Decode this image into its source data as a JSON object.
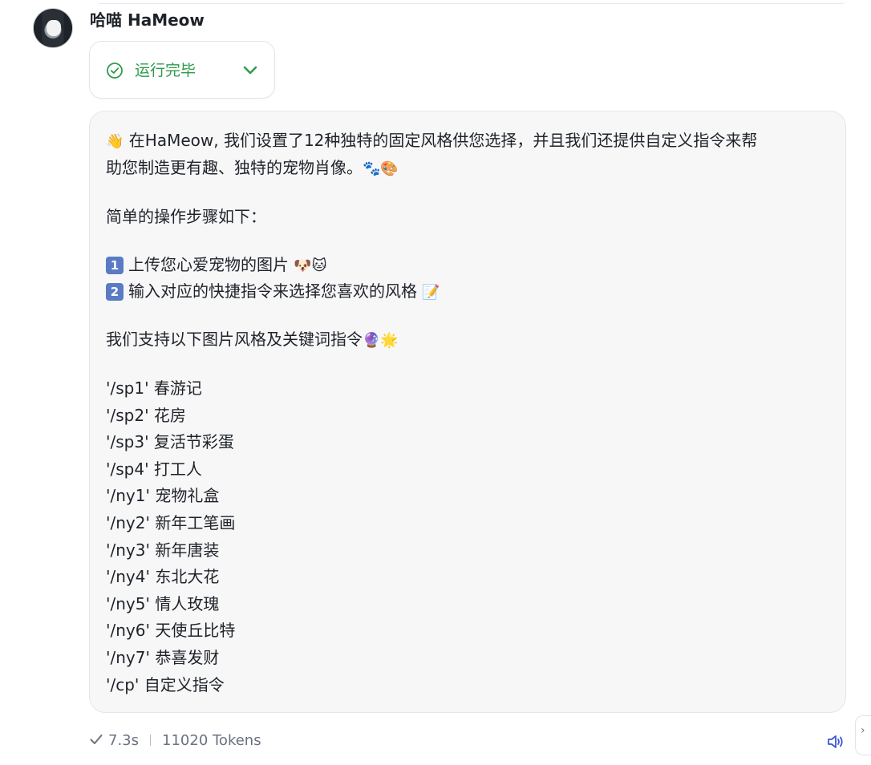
{
  "bot": {
    "name": "哈喵 HaMeow"
  },
  "status": {
    "label": "运行完毕",
    "icon": "check-circle-icon",
    "expand_icon": "chevron-down-icon",
    "color": "#2e9b4b"
  },
  "message": {
    "intro_emoji": "👋",
    "intro_line1": "在HaMeow, 我们设置了12种独特的固定风格供您选择，并且我们还提供自定义指令来帮",
    "intro_line2": "助您制造更有趣、独特的宠物肖像。",
    "intro_line2_emoji": "🐾🎨",
    "steps_title": "简单的操作步骤如下：",
    "steps": [
      {
        "badge": "1",
        "text": "上传您心爱宠物的图片",
        "emoji": "🐶🐱"
      },
      {
        "badge": "2",
        "text": "输入对应的快捷指令来选择您喜欢的风格",
        "emoji": "📝"
      }
    ],
    "styles_title": "我们支持以下图片风格及关键词指令",
    "styles_title_emoji": "🔮🌟",
    "commands": [
      "'/sp1' 春游记",
      "'/sp2' 花房",
      "'/sp3' 复活节彩蛋",
      "'/sp4' 打工人",
      "'/ny1' 宠物礼盒",
      "'/ny2' 新年工笔画",
      "'/ny3' 新年唐装",
      "'/ny4' 东北大花",
      "'/ny5' 情人玫瑰",
      "'/ny6' 天使丘比特",
      "'/ny7' 恭喜发财",
      "'/cp' 自定义指令"
    ],
    "background": "#f7f7f8"
  },
  "footer": {
    "time": "7.3s",
    "tokens": "11020 Tokens",
    "check_icon": "check-icon",
    "speaker_icon": "speaker-icon"
  },
  "side_tab": {
    "icon": "chevron-right-icon",
    "glyph": "›"
  }
}
